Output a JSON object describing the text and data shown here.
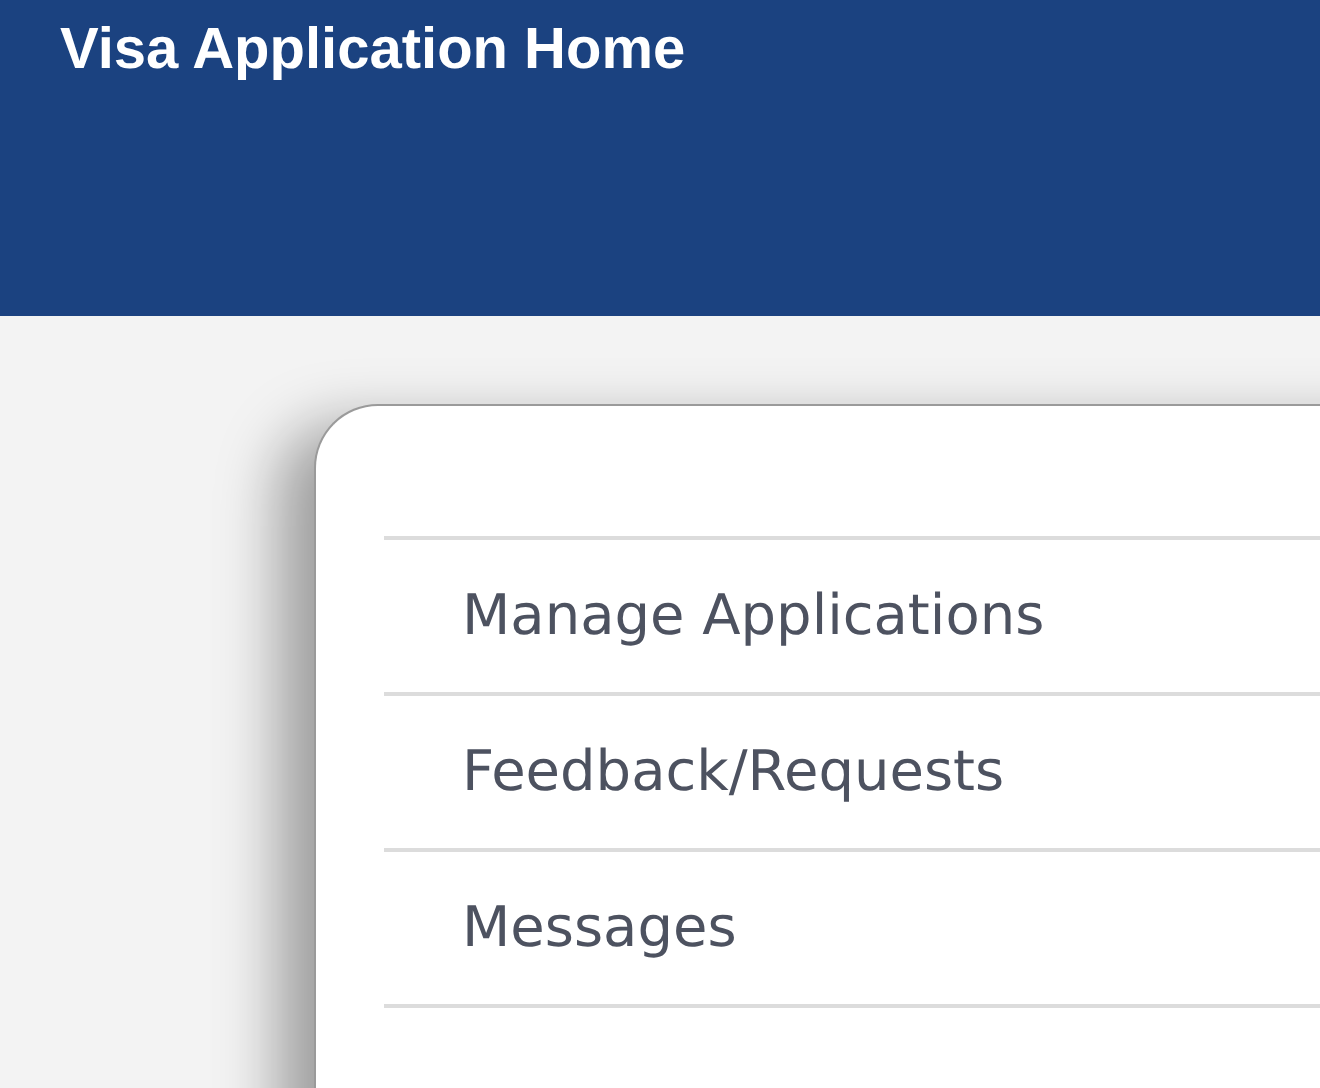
{
  "header": {
    "title": "Visa Application Home"
  },
  "menu": [
    {
      "label": "Manage Applications"
    },
    {
      "label": "Feedback/Requests"
    },
    {
      "label": "Messages"
    }
  ]
}
